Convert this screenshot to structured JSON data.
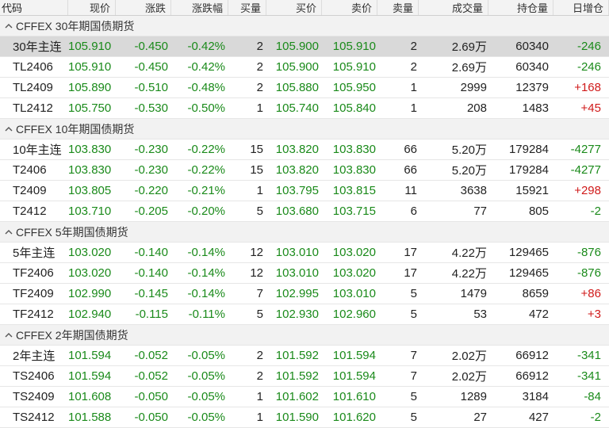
{
  "columns": [
    "代码",
    "现价",
    "涨跌",
    "涨跌幅",
    "买量",
    "买价",
    "卖价",
    "卖量",
    "成交量",
    "持仓量",
    "日增仓"
  ],
  "colors": {
    "up": "#d01a1a",
    "down": "#1a8a1a",
    "neutral": "#222222",
    "selected_row": "#d9d9d9",
    "group_bg": "#f2f2f2"
  },
  "groups": [
    {
      "label": "CFFEX 30年期国债期货",
      "icon": "chevron-up-icon",
      "rows": [
        {
          "code": "30年主连",
          "price": "105.910",
          "change": "-0.450",
          "pct": "-0.42%",
          "bid_vol": "2",
          "bid": "105.900",
          "ask": "105.910",
          "ask_vol": "2",
          "volume": "2.69万",
          "oi": "60340",
          "oi_chg": "-246",
          "chg_dir": "down",
          "selected": true
        },
        {
          "code": "TL2406",
          "price": "105.910",
          "change": "-0.450",
          "pct": "-0.42%",
          "bid_vol": "2",
          "bid": "105.900",
          "ask": "105.910",
          "ask_vol": "2",
          "volume": "2.69万",
          "oi": "60340",
          "oi_chg": "-246",
          "chg_dir": "down"
        },
        {
          "code": "TL2409",
          "price": "105.890",
          "change": "-0.510",
          "pct": "-0.48%",
          "bid_vol": "2",
          "bid": "105.880",
          "ask": "105.950",
          "ask_vol": "1",
          "volume": "2999",
          "oi": "12379",
          "oi_chg": "+168",
          "chg_dir": "up"
        },
        {
          "code": "TL2412",
          "price": "105.750",
          "change": "-0.530",
          "pct": "-0.50%",
          "bid_vol": "1",
          "bid": "105.740",
          "ask": "105.840",
          "ask_vol": "1",
          "volume": "208",
          "oi": "1483",
          "oi_chg": "+45",
          "chg_dir": "up"
        }
      ]
    },
    {
      "label": "CFFEX 10年期国债期货",
      "icon": "chevron-up-icon",
      "rows": [
        {
          "code": "10年主连",
          "price": "103.830",
          "change": "-0.230",
          "pct": "-0.22%",
          "bid_vol": "15",
          "bid": "103.820",
          "ask": "103.830",
          "ask_vol": "66",
          "volume": "5.20万",
          "oi": "179284",
          "oi_chg": "-4277",
          "chg_dir": "down"
        },
        {
          "code": "T2406",
          "price": "103.830",
          "change": "-0.230",
          "pct": "-0.22%",
          "bid_vol": "15",
          "bid": "103.820",
          "ask": "103.830",
          "ask_vol": "66",
          "volume": "5.20万",
          "oi": "179284",
          "oi_chg": "-4277",
          "chg_dir": "down"
        },
        {
          "code": "T2409",
          "price": "103.805",
          "change": "-0.220",
          "pct": "-0.21%",
          "bid_vol": "1",
          "bid": "103.795",
          "ask": "103.815",
          "ask_vol": "11",
          "volume": "3638",
          "oi": "15921",
          "oi_chg": "+298",
          "chg_dir": "up"
        },
        {
          "code": "T2412",
          "price": "103.710",
          "change": "-0.205",
          "pct": "-0.20%",
          "bid_vol": "5",
          "bid": "103.680",
          "ask": "103.715",
          "ask_vol": "6",
          "volume": "77",
          "oi": "805",
          "oi_chg": "-2",
          "chg_dir": "down"
        }
      ]
    },
    {
      "label": "CFFEX 5年期国债期货",
      "icon": "chevron-up-icon",
      "rows": [
        {
          "code": "5年主连",
          "price": "103.020",
          "change": "-0.140",
          "pct": "-0.14%",
          "bid_vol": "12",
          "bid": "103.010",
          "ask": "103.020",
          "ask_vol": "17",
          "volume": "4.22万",
          "oi": "129465",
          "oi_chg": "-876",
          "chg_dir": "down"
        },
        {
          "code": "TF2406",
          "price": "103.020",
          "change": "-0.140",
          "pct": "-0.14%",
          "bid_vol": "12",
          "bid": "103.010",
          "ask": "103.020",
          "ask_vol": "17",
          "volume": "4.22万",
          "oi": "129465",
          "oi_chg": "-876",
          "chg_dir": "down"
        },
        {
          "code": "TF2409",
          "price": "102.990",
          "change": "-0.145",
          "pct": "-0.14%",
          "bid_vol": "7",
          "bid": "102.995",
          "ask": "103.010",
          "ask_vol": "5",
          "volume": "1479",
          "oi": "8659",
          "oi_chg": "+86",
          "chg_dir": "up"
        },
        {
          "code": "TF2412",
          "price": "102.940",
          "change": "-0.115",
          "pct": "-0.11%",
          "bid_vol": "5",
          "bid": "102.930",
          "ask": "102.960",
          "ask_vol": "5",
          "volume": "53",
          "oi": "472",
          "oi_chg": "+3",
          "chg_dir": "up"
        }
      ]
    },
    {
      "label": "CFFEX 2年期国债期货",
      "icon": "chevron-up-icon",
      "rows": [
        {
          "code": "2年主连",
          "price": "101.594",
          "change": "-0.052",
          "pct": "-0.05%",
          "bid_vol": "2",
          "bid": "101.592",
          "ask": "101.594",
          "ask_vol": "7",
          "volume": "2.02万",
          "oi": "66912",
          "oi_chg": "-341",
          "chg_dir": "down"
        },
        {
          "code": "TS2406",
          "price": "101.594",
          "change": "-0.052",
          "pct": "-0.05%",
          "bid_vol": "2",
          "bid": "101.592",
          "ask": "101.594",
          "ask_vol": "7",
          "volume": "2.02万",
          "oi": "66912",
          "oi_chg": "-341",
          "chg_dir": "down"
        },
        {
          "code": "TS2409",
          "price": "101.608",
          "change": "-0.050",
          "pct": "-0.05%",
          "bid_vol": "1",
          "bid": "101.602",
          "ask": "101.610",
          "ask_vol": "5",
          "volume": "1289",
          "oi": "3184",
          "oi_chg": "-84",
          "chg_dir": "down"
        },
        {
          "code": "TS2412",
          "price": "101.588",
          "change": "-0.050",
          "pct": "-0.05%",
          "bid_vol": "1",
          "bid": "101.590",
          "ask": "101.620",
          "ask_vol": "5",
          "volume": "27",
          "oi": "427",
          "oi_chg": "-2",
          "chg_dir": "down"
        }
      ]
    }
  ]
}
